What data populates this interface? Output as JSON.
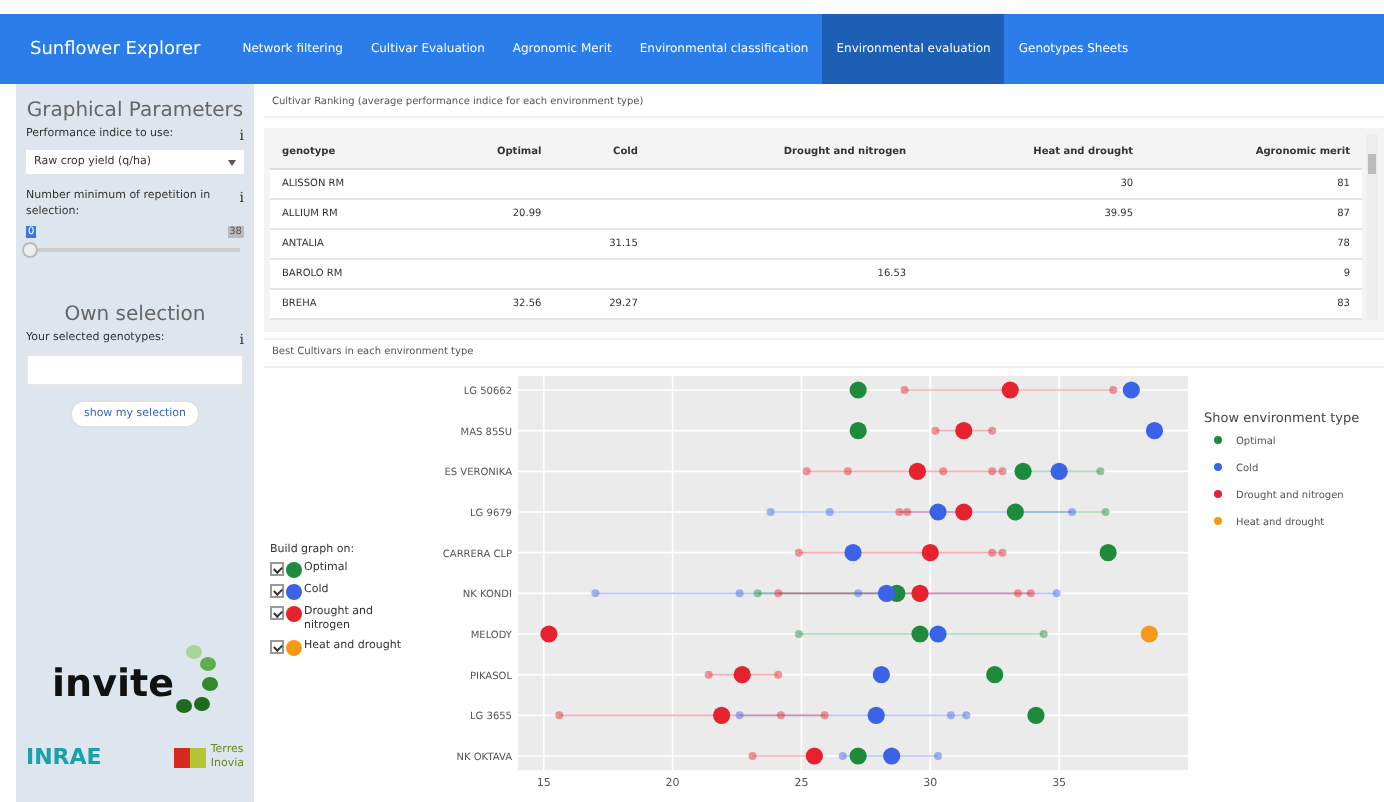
{
  "navbar": {
    "brand": "Sunflower Explorer",
    "tabs": [
      {
        "label": "Network filtering",
        "selected": false
      },
      {
        "label": "Cultivar Evaluation",
        "selected": false
      },
      {
        "label": "Agronomic Merit",
        "selected": false
      },
      {
        "label": "Environmental classification",
        "selected": false
      },
      {
        "label": "Environmental evaluation",
        "selected": true
      },
      {
        "label": "Genotypes Sheets",
        "selected": false
      }
    ]
  },
  "sidebar": {
    "title": "Graphical Parameters",
    "indice": {
      "label": "Performance indice to use:",
      "info": "i",
      "value": "Raw crop yield (q/ha)"
    },
    "repetition": {
      "label": "Number minimum of repetition in selection:",
      "info": "i",
      "min_label": "0",
      "max_label": "38",
      "level": 0
    },
    "own_title": "Own selection",
    "genotypes": {
      "label": "Your selected genotypes:",
      "info": "i"
    },
    "button": "show my selection",
    "logos": {
      "invite": "invite",
      "inrae": "INRAE",
      "terres": "Terres",
      "inovia": "Inovia"
    }
  },
  "ranking": {
    "title": "Cultivar Ranking (average performance indice for each environment type)",
    "columns": [
      "genotype",
      "Optimal",
      "Cold",
      "Drought and nitrogen",
      "Heat and drought",
      "Agronomic merit"
    ],
    "rows": [
      [
        "ALISSON RM",
        null,
        null,
        null,
        "30",
        "81"
      ],
      [
        "ALLIUM RM",
        "20.99",
        null,
        null,
        "39.95",
        "87"
      ],
      [
        "ANTALIA",
        null,
        "31.15",
        null,
        null,
        "78"
      ],
      [
        "BAROLO RM",
        null,
        null,
        "16.53",
        null,
        "9"
      ],
      [
        "BREHA",
        "32.56",
        "29.27",
        null,
        null,
        "83"
      ]
    ]
  },
  "best": {
    "title": "Best Cultivars in each environment type",
    "build_label": "Build graph on:",
    "environments": [
      {
        "label": "Optimal",
        "checked": true,
        "color": "#1e8a3c"
      },
      {
        "label": "Cold",
        "checked": true,
        "color": "#3b63e8"
      },
      {
        "label": "Drought and nitrogen",
        "checked": true,
        "color": "#e5222e"
      },
      {
        "label": "Heat and drought",
        "checked": true,
        "color": "#f59a16"
      }
    ],
    "chart_data": {
      "type": "scatter",
      "orientation": "horizontal",
      "grid": true,
      "legend": {
        "title": "Show environment type"
      },
      "categories": [
        "LG 50662",
        "MAS 85SU",
        "ES VERONIKA",
        "LG 9679",
        "CARRERA CLP",
        "NK KONDI",
        "MELODY",
        "PIKASOL",
        "LG 3655",
        "NK OKTAVA"
      ],
      "xlim": [
        14,
        40
      ],
      "xticks": [
        15,
        20,
        25,
        30,
        35
      ],
      "series": [
        {
          "name": "Optimal",
          "color": "#1e8a3c",
          "values": [
            27.2,
            27.2,
            33.6,
            33.3,
            36.9,
            28.7,
            29.6,
            32.5,
            34.1,
            27.2
          ]
        },
        {
          "name": "Cold",
          "color": "#3b63e8",
          "values": [
            37.8,
            38.7,
            35.0,
            30.3,
            27.0,
            28.3,
            30.3,
            28.1,
            27.9,
            28.5
          ]
        },
        {
          "name": "Drought and nitrogen",
          "color": "#e5222e",
          "values": [
            33.1,
            31.3,
            29.5,
            31.3,
            30.0,
            29.6,
            15.2,
            22.7,
            21.9,
            25.5
          ]
        },
        {
          "name": "Heat and drought",
          "color": "#f59a16",
          "values": [
            null,
            null,
            null,
            null,
            null,
            null,
            38.5,
            null,
            null,
            null
          ]
        },
        {
          "color": "#1e8a3c",
          "values": [
            null,
            null,
            36.6,
            36.8,
            null,
            23.3,
            24.9,
            null,
            null,
            null
          ]
        },
        {
          "color": "#1e8a3c",
          "values": [
            null,
            null,
            null,
            null,
            null,
            null,
            34.4,
            null,
            null,
            null
          ]
        },
        {
          "color": "#3b63e8",
          "values": [
            null,
            null,
            null,
            23.8,
            null,
            17.0,
            null,
            null,
            22.6,
            26.6
          ]
        },
        {
          "color": "#3b63e8",
          "values": [
            null,
            null,
            null,
            26.1,
            null,
            22.6,
            null,
            null,
            30.8,
            30.3
          ]
        },
        {
          "color": "#3b63e8",
          "values": [
            null,
            null,
            null,
            35.5,
            null,
            27.2,
            null,
            null,
            31.4,
            null
          ]
        },
        {
          "color": "#3b63e8",
          "values": [
            null,
            null,
            null,
            null,
            null,
            34.9,
            null,
            null,
            null,
            null
          ]
        },
        {
          "color": "#e5222e",
          "values": [
            29.0,
            30.2,
            25.2,
            28.8,
            24.9,
            24.1,
            null,
            21.4,
            15.6,
            23.1
          ]
        },
        {
          "color": "#e5222e",
          "values": [
            37.1,
            32.4,
            26.8,
            29.1,
            32.4,
            33.4,
            null,
            24.1,
            24.2,
            null
          ]
        },
        {
          "color": "#e5222e",
          "values": [
            null,
            null,
            30.5,
            null,
            32.8,
            33.9,
            null,
            null,
            25.9,
            null
          ]
        },
        {
          "color": "#e5222e",
          "values": [
            null,
            null,
            32.4,
            null,
            null,
            null,
            null,
            null,
            null,
            null
          ]
        },
        {
          "color": "#e5222e",
          "values": [
            null,
            null,
            32.8,
            null,
            null,
            null,
            null,
            null,
            null,
            null
          ]
        }
      ]
    }
  }
}
